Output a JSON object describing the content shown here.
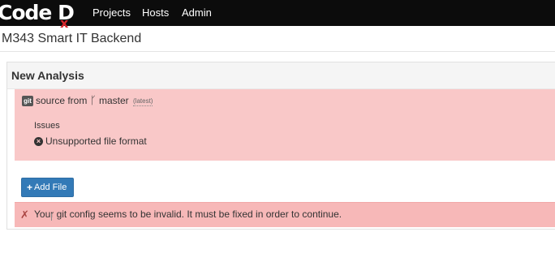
{
  "navbar": {
    "logo_text": "Code D",
    "logo_mark": "x",
    "links": [
      "Projects",
      "Hosts",
      "Admin"
    ]
  },
  "page": {
    "title": "M343 Smart IT Backend"
  },
  "panel": {
    "title": "New Analysis",
    "source": {
      "badge": "git",
      "label": "source from",
      "branch_icon": "git-branch-icon",
      "branch": "master",
      "tag": "(latest)"
    },
    "issues": {
      "label": "Issues",
      "items": [
        "Unsupported file format"
      ]
    },
    "add_file_button": "Add File",
    "alert": {
      "icon": "✗",
      "message": "Your git config seems to be invalid. It must be fixed in order to continue."
    }
  },
  "colors": {
    "navbar": "#0c0c0c",
    "error_bg": "#f9c8c8",
    "alert_bg": "#f7b8b8",
    "button": "#337ab7",
    "logo_accent": "#d6262c"
  }
}
